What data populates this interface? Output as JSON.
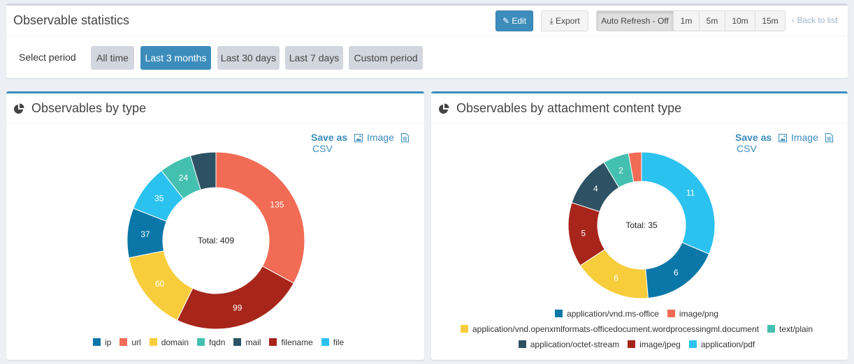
{
  "header": {
    "title": "Observable statistics",
    "edit_label": "Edit",
    "export_label": "Export",
    "auto_refresh_label": "Auto Refresh - Off",
    "intervals": [
      "1m",
      "5m",
      "10m",
      "15m"
    ],
    "back_label": "Back to list"
  },
  "period": {
    "label": "Select period",
    "options": [
      "All time",
      "Last 3 months",
      "Last 30 days",
      "Last 7 days",
      "Custom period"
    ],
    "selected": "Last 3 months"
  },
  "save": {
    "save_as": "Save as",
    "image": "Image",
    "csv": "CSV"
  },
  "panels": {
    "by_type": {
      "title": "Observables by type",
      "total_label": "Total: 409"
    },
    "by_attachment": {
      "title": "Observables by attachment content type",
      "total_label": "Total: 35"
    }
  },
  "chart_data": [
    {
      "type": "pie",
      "title": "Observables by type",
      "center_label": "Total: 409",
      "categories": [
        "ip",
        "url",
        "domain",
        "fqdn",
        "mail",
        "filename",
        "file"
      ],
      "values": [
        37,
        135,
        60,
        24,
        19,
        99,
        35
      ],
      "slice_labels": [
        "37",
        "135",
        "60",
        "24",
        "",
        "99",
        "35"
      ],
      "slice_order": [
        "url",
        "filename",
        "domain",
        "ip",
        "file",
        "fqdn",
        "mail"
      ],
      "colors": {
        "ip": "#0a77a8",
        "url": "#f26b55",
        "domain": "#f7cd3c",
        "fqdn": "#44c0b0",
        "mail": "#2c5263",
        "filename": "#a7251a",
        "file": "#2bc2ef"
      },
      "legend": "bottom"
    },
    {
      "type": "pie",
      "title": "Observables by attachment content type",
      "center_label": "Total: 35",
      "categories": [
        "application/vnd.ms-office",
        "image/png",
        "application/vnd.openxmlformats-officedocument.wordprocessingml.document",
        "text/plain",
        "application/octet-stream",
        "image/jpeg",
        "application/pdf"
      ],
      "values": [
        6,
        1,
        6,
        2,
        4,
        5,
        11
      ],
      "slice_labels": [
        "6",
        "",
        "6",
        "2",
        "4",
        "5",
        "11"
      ],
      "slice_order": [
        "application/pdf",
        "application/vnd.ms-office",
        "application/vnd.openxmlformats-officedocument.wordprocessingml.document",
        "image/jpeg",
        "application/octet-stream",
        "text/plain",
        "image/png"
      ],
      "colors": {
        "application/vnd.ms-office": "#0a77a8",
        "image/png": "#f26b55",
        "application/vnd.openxmlformats-officedocument.wordprocessingml.document": "#f7cd3c",
        "text/plain": "#44c0b0",
        "application/octet-stream": "#2c5263",
        "image/jpeg": "#a7251a",
        "application/pdf": "#2bc2ef"
      },
      "legend": "bottom"
    }
  ]
}
